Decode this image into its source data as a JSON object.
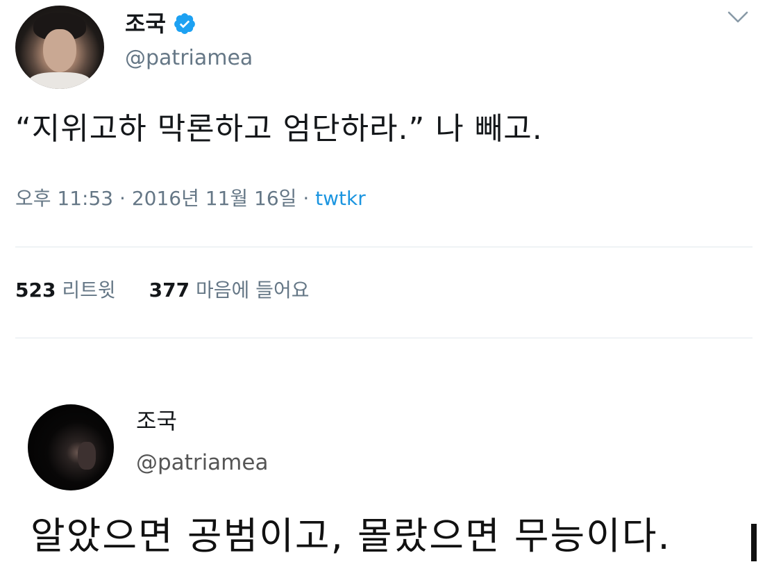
{
  "tweet_main": {
    "author_name": "조국",
    "verified_icon": "verified-badge-icon",
    "handle": "@patriamea",
    "text": "“지위고하 막론하고 엄단하라.” 나 빼고.",
    "time": "오후 11:53",
    "date": "2016년 11월 16일",
    "source": "twtkr",
    "separator": "·",
    "retweets_count": "523",
    "retweets_label": "리트윗",
    "likes_count": "377",
    "likes_label": "마음에 들어요",
    "menu_icon": "chevron-down-icon"
  },
  "tweet_quoted": {
    "author_name": "조국",
    "handle": "@patriamea",
    "text": "알았으면 공범이고, 몰랐으면 무능이다."
  },
  "colors": {
    "verified_blue": "#1da1f2",
    "link_blue": "#1b95e0",
    "secondary_text": "#657786",
    "divider": "#e1e8ed"
  }
}
